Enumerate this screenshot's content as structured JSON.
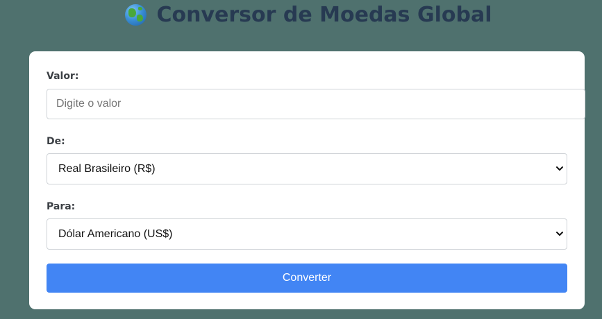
{
  "header": {
    "title": "Conversor de Moedas Global",
    "icon": "globe-icon"
  },
  "form": {
    "amount": {
      "label": "Valor:",
      "placeholder": "Digite o valor",
      "value": ""
    },
    "from": {
      "label": "De:",
      "selected": "Real Brasileiro (R$)"
    },
    "to": {
      "label": "Para:",
      "selected": "Dólar Americano (US$)"
    },
    "submit_label": "Converter"
  },
  "colors": {
    "background": "#4f716e",
    "title": "#273a52",
    "card": "#ffffff",
    "button": "#4285f4",
    "button_text": "#ffffff"
  }
}
